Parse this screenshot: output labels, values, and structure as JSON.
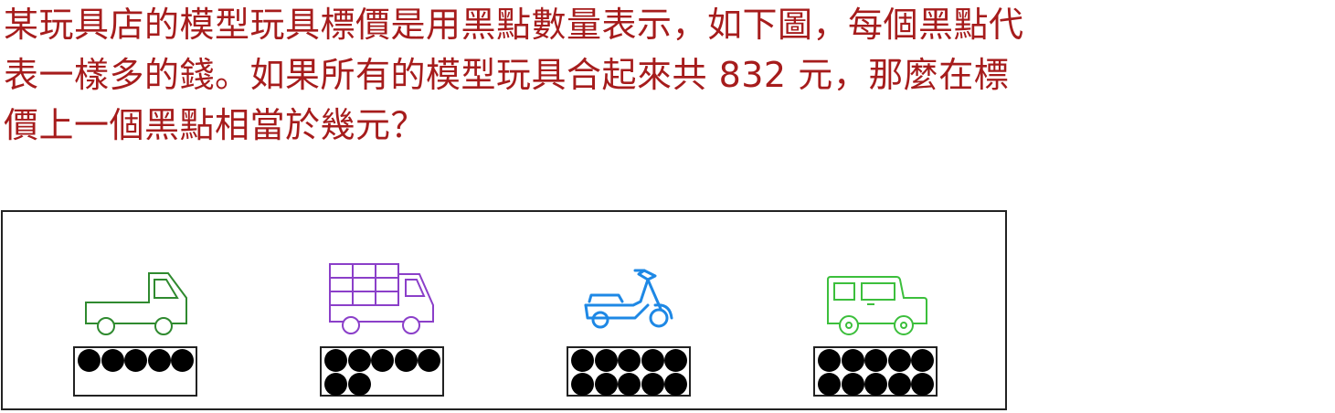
{
  "question": {
    "lines": [
      "某玩具店的模型玩具標價是用黑點數量表示，如下圖，每個黑點代",
      "表一樣多的錢。如果所有的模型玩具合起來共 832 元，那麼在標",
      "價上一個黑點相當於幾元？"
    ],
    "color": "#a61c1c"
  },
  "toys": [
    {
      "icon": "pickup-truck-icon",
      "color": "#2f8a2f",
      "dots": 5
    },
    {
      "icon": "box-truck-icon",
      "color": "#8b3fc9",
      "dots": 7
    },
    {
      "icon": "scooter-icon",
      "color": "#1e88e5",
      "dots": 10
    },
    {
      "icon": "jeep-icon",
      "color": "#3cbf3c",
      "dots": 10
    }
  ]
}
